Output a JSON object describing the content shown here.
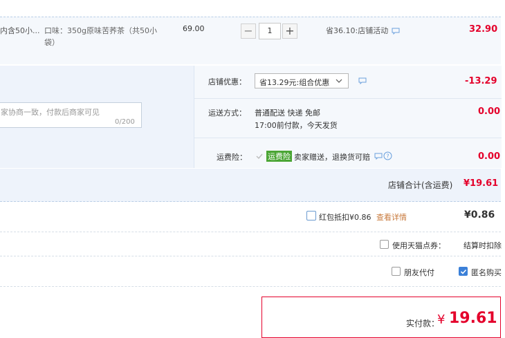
{
  "product": {
    "name_fragment": "内含50小...",
    "spec_line1": "口味：350g原味苦荞茶（共50小",
    "spec_line2": "袋）",
    "unit_price": "69.00",
    "qty_minus": "−",
    "qty_value": "1",
    "qty_plus": "+",
    "promo": "省36.10:店铺活动",
    "subtotal": "32.90"
  },
  "order_info": {
    "message_placeholder": "家协商一致，付款后商家可见",
    "message_counter": "0/200",
    "shop_discount_label": "店铺优惠：",
    "shop_discount_select": "省13.29元:组合优惠",
    "shop_discount_amount": "-13.29",
    "shipping_label": "运送方式：",
    "shipping_line1": "普通配送 快递 免邮",
    "shipping_line2": "17:00前付款，今天发货",
    "shipping_amount": "0.00",
    "insurance_label": "运费险：",
    "insurance_badge": "运费险",
    "insurance_text": "卖家赠送，退换货可赔",
    "insurance_amount": "0.00"
  },
  "shop_total": {
    "label": "店铺合计(含运费)",
    "amount": "¥19.61"
  },
  "options": {
    "red_packet_label": "红包抵扣¥0.86",
    "red_packet_link": "查看详情",
    "red_packet_amount": "¥0.86",
    "tmall_points_label": "使用天猫点券：",
    "tmall_points_note": "结算时扣除",
    "friend_pay_label": "朋友代付",
    "anonymous_label": "匿名购买"
  },
  "payment": {
    "label": "实付款：",
    "currency": "¥",
    "amount": "19.61"
  },
  "colors": {
    "price_red": "#e4002b",
    "link_orange": "#c87a3c",
    "badge_green": "#4aa534",
    "checkbox_blue": "#3b80d8"
  }
}
